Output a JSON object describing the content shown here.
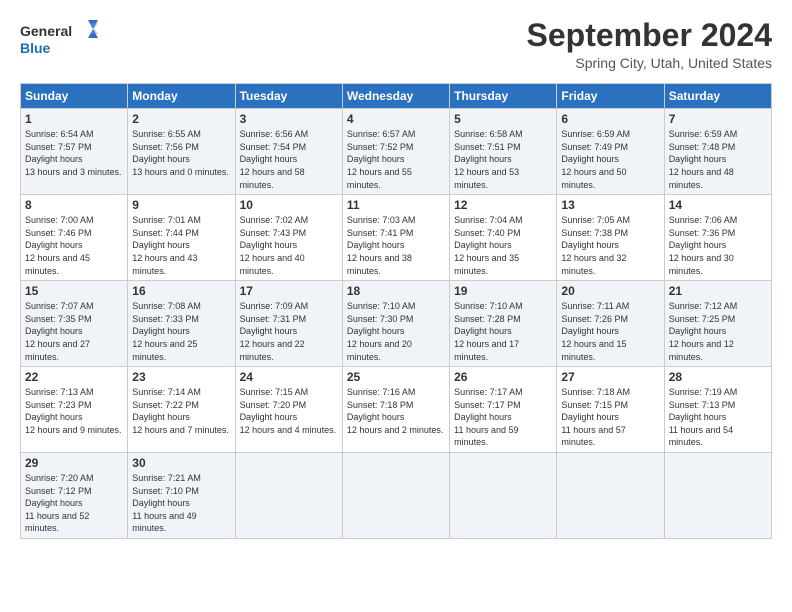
{
  "header": {
    "logo_line1": "General",
    "logo_line2": "Blue",
    "month_title": "September 2024",
    "location": "Spring City, Utah, United States"
  },
  "days_of_week": [
    "Sunday",
    "Monday",
    "Tuesday",
    "Wednesday",
    "Thursday",
    "Friday",
    "Saturday"
  ],
  "weeks": [
    [
      {
        "day": "1",
        "sunrise": "6:54 AM",
        "sunset": "7:57 PM",
        "daylight": "13 hours and 3 minutes."
      },
      {
        "day": "2",
        "sunrise": "6:55 AM",
        "sunset": "7:56 PM",
        "daylight": "13 hours and 0 minutes."
      },
      {
        "day": "3",
        "sunrise": "6:56 AM",
        "sunset": "7:54 PM",
        "daylight": "12 hours and 58 minutes."
      },
      {
        "day": "4",
        "sunrise": "6:57 AM",
        "sunset": "7:52 PM",
        "daylight": "12 hours and 55 minutes."
      },
      {
        "day": "5",
        "sunrise": "6:58 AM",
        "sunset": "7:51 PM",
        "daylight": "12 hours and 53 minutes."
      },
      {
        "day": "6",
        "sunrise": "6:59 AM",
        "sunset": "7:49 PM",
        "daylight": "12 hours and 50 minutes."
      },
      {
        "day": "7",
        "sunrise": "6:59 AM",
        "sunset": "7:48 PM",
        "daylight": "12 hours and 48 minutes."
      }
    ],
    [
      {
        "day": "8",
        "sunrise": "7:00 AM",
        "sunset": "7:46 PM",
        "daylight": "12 hours and 45 minutes."
      },
      {
        "day": "9",
        "sunrise": "7:01 AM",
        "sunset": "7:44 PM",
        "daylight": "12 hours and 43 minutes."
      },
      {
        "day": "10",
        "sunrise": "7:02 AM",
        "sunset": "7:43 PM",
        "daylight": "12 hours and 40 minutes."
      },
      {
        "day": "11",
        "sunrise": "7:03 AM",
        "sunset": "7:41 PM",
        "daylight": "12 hours and 38 minutes."
      },
      {
        "day": "12",
        "sunrise": "7:04 AM",
        "sunset": "7:40 PM",
        "daylight": "12 hours and 35 minutes."
      },
      {
        "day": "13",
        "sunrise": "7:05 AM",
        "sunset": "7:38 PM",
        "daylight": "12 hours and 32 minutes."
      },
      {
        "day": "14",
        "sunrise": "7:06 AM",
        "sunset": "7:36 PM",
        "daylight": "12 hours and 30 minutes."
      }
    ],
    [
      {
        "day": "15",
        "sunrise": "7:07 AM",
        "sunset": "7:35 PM",
        "daylight": "12 hours and 27 minutes."
      },
      {
        "day": "16",
        "sunrise": "7:08 AM",
        "sunset": "7:33 PM",
        "daylight": "12 hours and 25 minutes."
      },
      {
        "day": "17",
        "sunrise": "7:09 AM",
        "sunset": "7:31 PM",
        "daylight": "12 hours and 22 minutes."
      },
      {
        "day": "18",
        "sunrise": "7:10 AM",
        "sunset": "7:30 PM",
        "daylight": "12 hours and 20 minutes."
      },
      {
        "day": "19",
        "sunrise": "7:10 AM",
        "sunset": "7:28 PM",
        "daylight": "12 hours and 17 minutes."
      },
      {
        "day": "20",
        "sunrise": "7:11 AM",
        "sunset": "7:26 PM",
        "daylight": "12 hours and 15 minutes."
      },
      {
        "day": "21",
        "sunrise": "7:12 AM",
        "sunset": "7:25 PM",
        "daylight": "12 hours and 12 minutes."
      }
    ],
    [
      {
        "day": "22",
        "sunrise": "7:13 AM",
        "sunset": "7:23 PM",
        "daylight": "12 hours and 9 minutes."
      },
      {
        "day": "23",
        "sunrise": "7:14 AM",
        "sunset": "7:22 PM",
        "daylight": "12 hours and 7 minutes."
      },
      {
        "day": "24",
        "sunrise": "7:15 AM",
        "sunset": "7:20 PM",
        "daylight": "12 hours and 4 minutes."
      },
      {
        "day": "25",
        "sunrise": "7:16 AM",
        "sunset": "7:18 PM",
        "daylight": "12 hours and 2 minutes."
      },
      {
        "day": "26",
        "sunrise": "7:17 AM",
        "sunset": "7:17 PM",
        "daylight": "11 hours and 59 minutes."
      },
      {
        "day": "27",
        "sunrise": "7:18 AM",
        "sunset": "7:15 PM",
        "daylight": "11 hours and 57 minutes."
      },
      {
        "day": "28",
        "sunrise": "7:19 AM",
        "sunset": "7:13 PM",
        "daylight": "11 hours and 54 minutes."
      }
    ],
    [
      {
        "day": "29",
        "sunrise": "7:20 AM",
        "sunset": "7:12 PM",
        "daylight": "11 hours and 52 minutes."
      },
      {
        "day": "30",
        "sunrise": "7:21 AM",
        "sunset": "7:10 PM",
        "daylight": "11 hours and 49 minutes."
      },
      null,
      null,
      null,
      null,
      null
    ]
  ]
}
